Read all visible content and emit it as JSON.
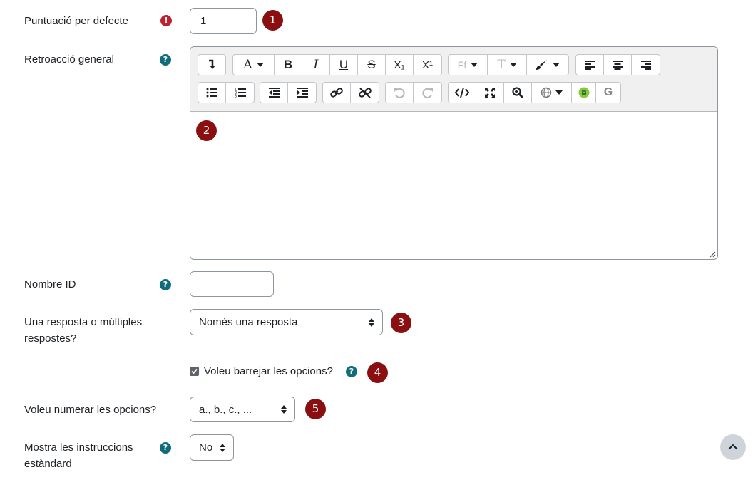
{
  "fields": {
    "default_mark": {
      "label": "Puntuació per defecte",
      "value": "1",
      "badge": "1",
      "icon": "exclamation-circle-icon"
    },
    "general_feedback": {
      "label": "Retroacció general",
      "badge": "2",
      "icon": "question-circle-icon"
    },
    "id_number": {
      "label": "Nombre ID",
      "value": "",
      "icon": "question-circle-icon"
    },
    "single_multiple": {
      "label": "Una resposta o múltiples respostes?",
      "value": "Només una resposta",
      "badge": "3"
    },
    "shuffle": {
      "label": "Voleu barrejar les opcions?",
      "checked": true,
      "badge": "4",
      "icon": "question-circle-icon"
    },
    "numbering": {
      "label": "Voleu numerar les opcions?",
      "value": "a., b., c., ...",
      "badge": "5"
    },
    "std_instructions": {
      "label": "Mostra les instruccions estàndard",
      "value": "No",
      "icon": "question-circle-icon"
    }
  },
  "toolbar": {
    "font_button": "A",
    "bold": "B",
    "italic": "I",
    "underline": "U",
    "strike": "S",
    "subscript": "X₁",
    "superscript": "X¹",
    "font_family": "Ff",
    "font_size": "T",
    "spellcheck": "G"
  },
  "icons": {
    "help": "?",
    "required": "!"
  },
  "colors": {
    "badge": "#8a0f10",
    "help": "#0f6c7a",
    "required": "#c01f2f"
  }
}
